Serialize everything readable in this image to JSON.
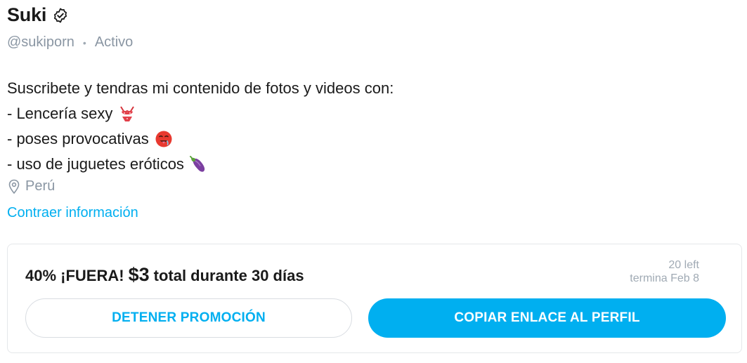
{
  "profile": {
    "name": "Suki",
    "handle": "@sukiporn",
    "status": "Activo",
    "bio": {
      "intro": "Suscribete y tendras mi contenido de fotos y videos con:",
      "items": [
        "- Lencería sexy",
        "- poses provocativas",
        "- uso de juguetes eróticos"
      ],
      "emojis": [
        "bikini-emoji",
        "drooling-face-emoji",
        "eggplant-emoji"
      ]
    },
    "location": "Perú",
    "collapse_label": "Contraer información"
  },
  "promo": {
    "text_before": "40% ¡FUERA!",
    "price": "$3",
    "text_after": "total durante 30 días",
    "left": "20 left",
    "ends": "termina Feb 8",
    "stop_label": "DETENER PROMOCIÓN",
    "copy_label": "COPIAR ENLACE AL PERFIL"
  },
  "colors": {
    "accent": "#00aff0",
    "muted": "#8a96a3",
    "text": "#1a1a1a",
    "border": "#e5e7ea"
  }
}
